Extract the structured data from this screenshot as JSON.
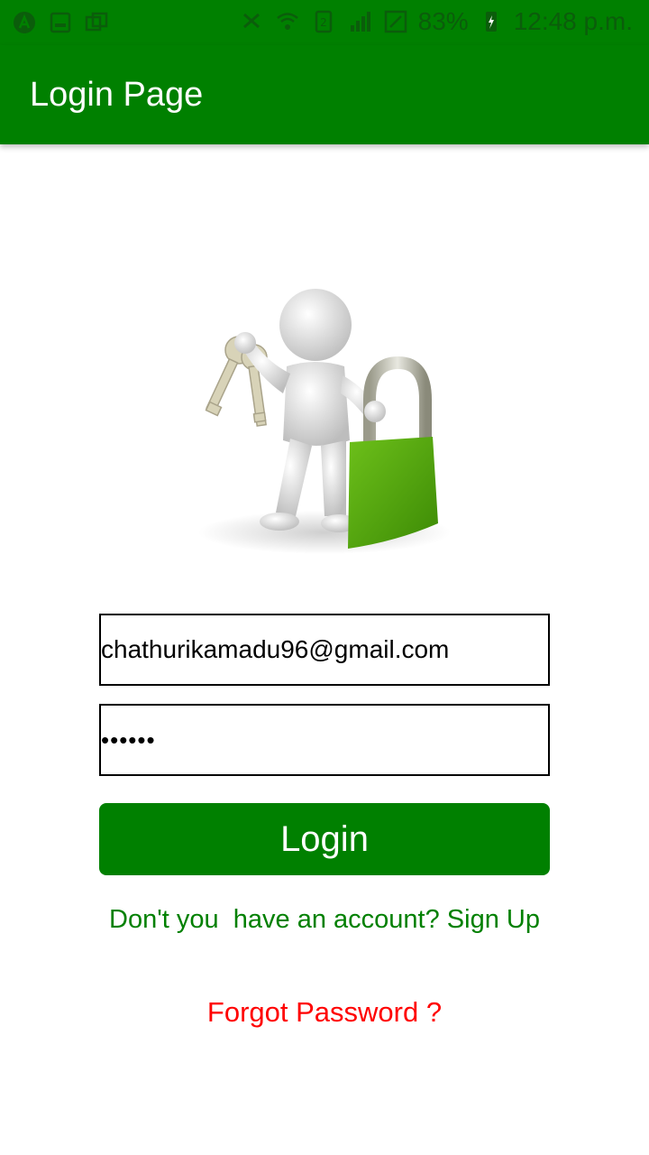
{
  "status_bar": {
    "icons_left": [
      "assistant-icon",
      "gallery-icon",
      "multi-window-icon"
    ],
    "icons_right": [
      "mute-icon",
      "wifi-icon",
      "sim2-icon",
      "signal-icon",
      "no-sim-icon"
    ],
    "battery_percent": "83%",
    "time": "12:48 p.m."
  },
  "app_bar": {
    "title": "Login Page"
  },
  "form": {
    "email_value": "chathurikamadu96@gmail.com",
    "password_value": "••••••",
    "login_label": "Login",
    "signup_text": "Don't you  have an account? Sign Up",
    "forgot_text": "Forgot Password ?"
  },
  "colors": {
    "primary": "#008000",
    "link_green": "#008000",
    "link_red": "#ff0000",
    "white": "#ffffff"
  }
}
